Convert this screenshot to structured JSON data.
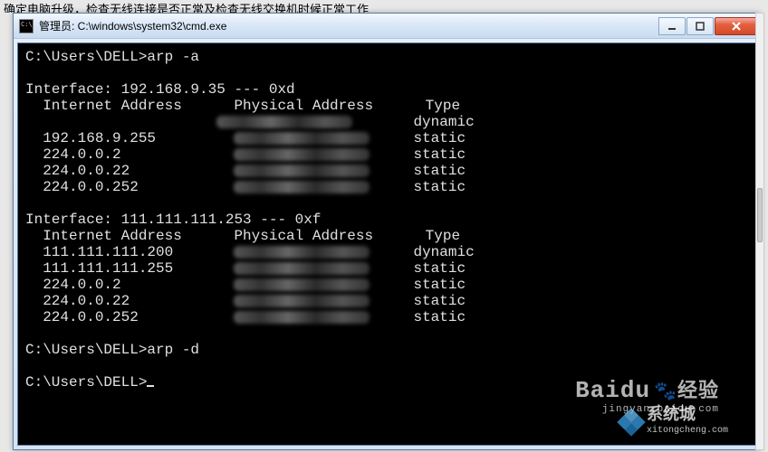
{
  "top_cut_text": "确定电脑升级，检查无线连接是否正常及检查无线交换机时候正常工作",
  "window": {
    "title": "管理员: C:\\windows\\system32\\cmd.exe"
  },
  "console": {
    "prompt1": "C:\\Users\\DELL>",
    "command1": "arp -a",
    "if1_header": "Interface: 192.168.9.35 --- 0xd",
    "col_inet": "Internet Address",
    "col_phys": "Physical Address",
    "col_type": "Type",
    "if1_rows": [
      {
        "ip": "",
        "type": "dynamic"
      },
      {
        "ip": "192.168.9.255",
        "type": "static"
      },
      {
        "ip": "224.0.0.2",
        "type": "static"
      },
      {
        "ip": "224.0.0.22",
        "type": "static"
      },
      {
        "ip": "224.0.0.252",
        "type": "static"
      }
    ],
    "if2_header": "Interface: 111.111.111.253 --- 0xf",
    "if2_rows": [
      {
        "ip": "111.111.111.200",
        "type": "dynamic"
      },
      {
        "ip": "111.111.111.255",
        "type": "static"
      },
      {
        "ip": "224.0.0.2",
        "type": "static"
      },
      {
        "ip": "224.0.0.22",
        "type": "static"
      },
      {
        "ip": "224.0.0.252",
        "type": "static"
      }
    ],
    "prompt2": "C:\\Users\\DELL>",
    "command2": "arp -d",
    "prompt3": "C:\\Users\\DELL>"
  },
  "watermarks": {
    "baidu_logo": "Baidu",
    "baidu_cn": "经验",
    "baidu_url": "jingyan.baidu.com",
    "xt_cn": "系统城",
    "xt_url": "xitongcheng.com"
  }
}
